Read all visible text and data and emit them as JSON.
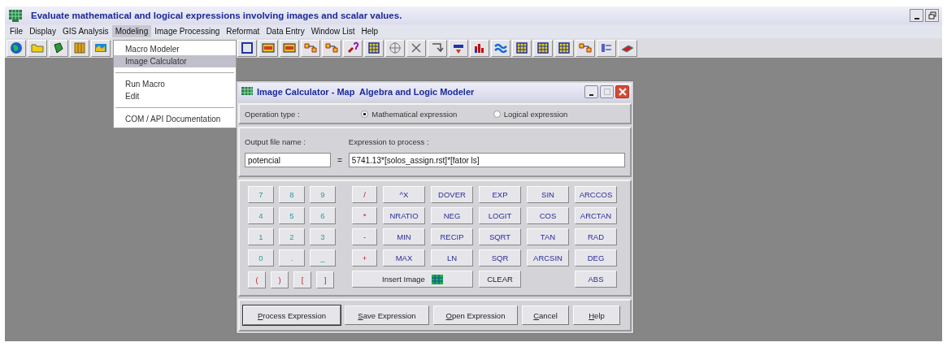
{
  "window": {
    "title": "Evaluate mathematical and logical expressions involving images and scalar values."
  },
  "menu_bar": [
    {
      "label": "File",
      "selected": false
    },
    {
      "label": "Display",
      "selected": false
    },
    {
      "label": "GIS Analysis",
      "selected": false
    },
    {
      "label": "Modeling",
      "selected": true
    },
    {
      "label": "Image Processing",
      "selected": false
    },
    {
      "label": "Reformat",
      "selected": false
    },
    {
      "label": "Data Entry",
      "selected": false
    },
    {
      "label": "Window List",
      "selected": false
    },
    {
      "label": "Help",
      "selected": false
    }
  ],
  "dropdown": {
    "groups": [
      [
        {
          "label": "Macro Modeler",
          "selected": false
        },
        {
          "label": "Image Calculator",
          "selected": true
        }
      ],
      [
        {
          "label": "Run Macro",
          "selected": false
        },
        {
          "label": "Edit",
          "selected": false
        }
      ],
      [
        {
          "label": "COM / API Documentation",
          "selected": false
        }
      ]
    ]
  },
  "dialog": {
    "title": "Image Calculator - Map  Algebra and Logic Modeler",
    "operation_label": "Operation type :",
    "operation_types": [
      {
        "label": "Mathematical expression",
        "selected": true
      },
      {
        "label": "Logical expression",
        "selected": false
      }
    ],
    "output_label": "Output file name :",
    "output_value": "potencial",
    "equals": "=",
    "expression_label": "Expression to process :",
    "expression_value": "5741.13*[solos_assign.rst]*[fator ls]",
    "left_keys": [
      {
        "label": "7",
        "kind": "digit"
      },
      {
        "label": "8",
        "kind": "digit"
      },
      {
        "label": "9",
        "kind": "digit"
      },
      {
        "label": "4",
        "kind": "digit"
      },
      {
        "label": "5",
        "kind": "digit"
      },
      {
        "label": "6",
        "kind": "digit"
      },
      {
        "label": "1",
        "kind": "digit"
      },
      {
        "label": "2",
        "kind": "digit"
      },
      {
        "label": "3",
        "kind": "digit"
      },
      {
        "label": "0",
        "kind": "digit"
      },
      {
        "label": ".",
        "kind": "digit"
      },
      {
        "label": "_",
        "kind": "digit"
      }
    ],
    "paren_keys": [
      {
        "label": "(",
        "kind": "operator"
      },
      {
        "label": ")",
        "kind": "operator"
      },
      {
        "label": "[",
        "kind": "operator"
      },
      {
        "label": "]",
        "kind": "operator"
      }
    ],
    "right_keys": [
      {
        "label": "/",
        "kind": "operator"
      },
      {
        "label": "^X",
        "kind": "function"
      },
      {
        "label": "DOVER",
        "kind": "function"
      },
      {
        "label": "EXP",
        "kind": "function"
      },
      {
        "label": "SIN",
        "kind": "function"
      },
      {
        "label": "ARCCOS",
        "kind": "function"
      },
      {
        "label": "*",
        "kind": "operator"
      },
      {
        "label": "NRATIO",
        "kind": "function"
      },
      {
        "label": "NEG",
        "kind": "function"
      },
      {
        "label": "LOGIT",
        "kind": "function"
      },
      {
        "label": "COS",
        "kind": "function"
      },
      {
        "label": "ARCTAN",
        "kind": "function"
      },
      {
        "label": "-",
        "kind": "operator"
      },
      {
        "label": "MIN",
        "kind": "function"
      },
      {
        "label": "RECIP",
        "kind": "function"
      },
      {
        "label": "SQRT",
        "kind": "function"
      },
      {
        "label": "TAN",
        "kind": "function"
      },
      {
        "label": "RAD",
        "kind": "function"
      },
      {
        "label": "+",
        "kind": "operator"
      },
      {
        "label": "MAX",
        "kind": "function"
      },
      {
        "label": "LN",
        "kind": "function"
      },
      {
        "label": "SQR",
        "kind": "function"
      },
      {
        "label": "ARCSIN",
        "kind": "function"
      },
      {
        "label": "DEG",
        "kind": "function"
      }
    ],
    "bottom_keys": [
      {
        "label": "Insert Image",
        "kind": "insert"
      },
      {
        "label": "CLEAR",
        "kind": "clear"
      },
      {
        "label": "ABS",
        "kind": "function"
      }
    ],
    "buttons": [
      {
        "label": "Process Expression",
        "selected": true
      },
      {
        "label": "Save Expression",
        "selected": false
      },
      {
        "label": "Open Expression",
        "selected": false
      },
      {
        "label": "Cancel",
        "selected": false
      },
      {
        "label": "Help",
        "selected": false
      }
    ]
  }
}
